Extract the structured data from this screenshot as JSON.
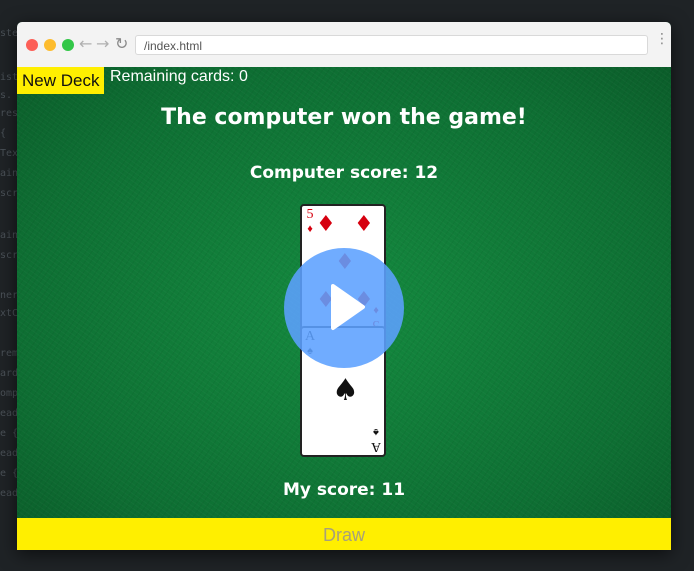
{
  "browser": {
    "address": "/index.html",
    "icons": [
      "back-arrow-icon",
      "forward-arrow-icon",
      "reload-icon",
      "kebab-menu-icon"
    ]
  },
  "game": {
    "new_deck_label": "New Deck",
    "remaining_cards": "Remaining cards: 0",
    "result_message": "The computer won the game!",
    "computer_score": "Computer score: 12",
    "my_score": "My score: 11",
    "draw_label": "Draw"
  },
  "cards": {
    "computer_card": {
      "rank": "5",
      "suit": "diamonds",
      "suit_symbol": "♦",
      "color": "#d6000f"
    },
    "player_card": {
      "rank": "A",
      "suit": "spades",
      "suit_symbol": "♠",
      "color": "#111111"
    }
  },
  "video_overlay": {
    "icon": "play-icon",
    "color": "#5ca0ff"
  },
  "colors": {
    "table_green": "#0f6b33",
    "button_yellow": "#ffef00",
    "draw_text_disabled": "#a7a07b"
  }
}
